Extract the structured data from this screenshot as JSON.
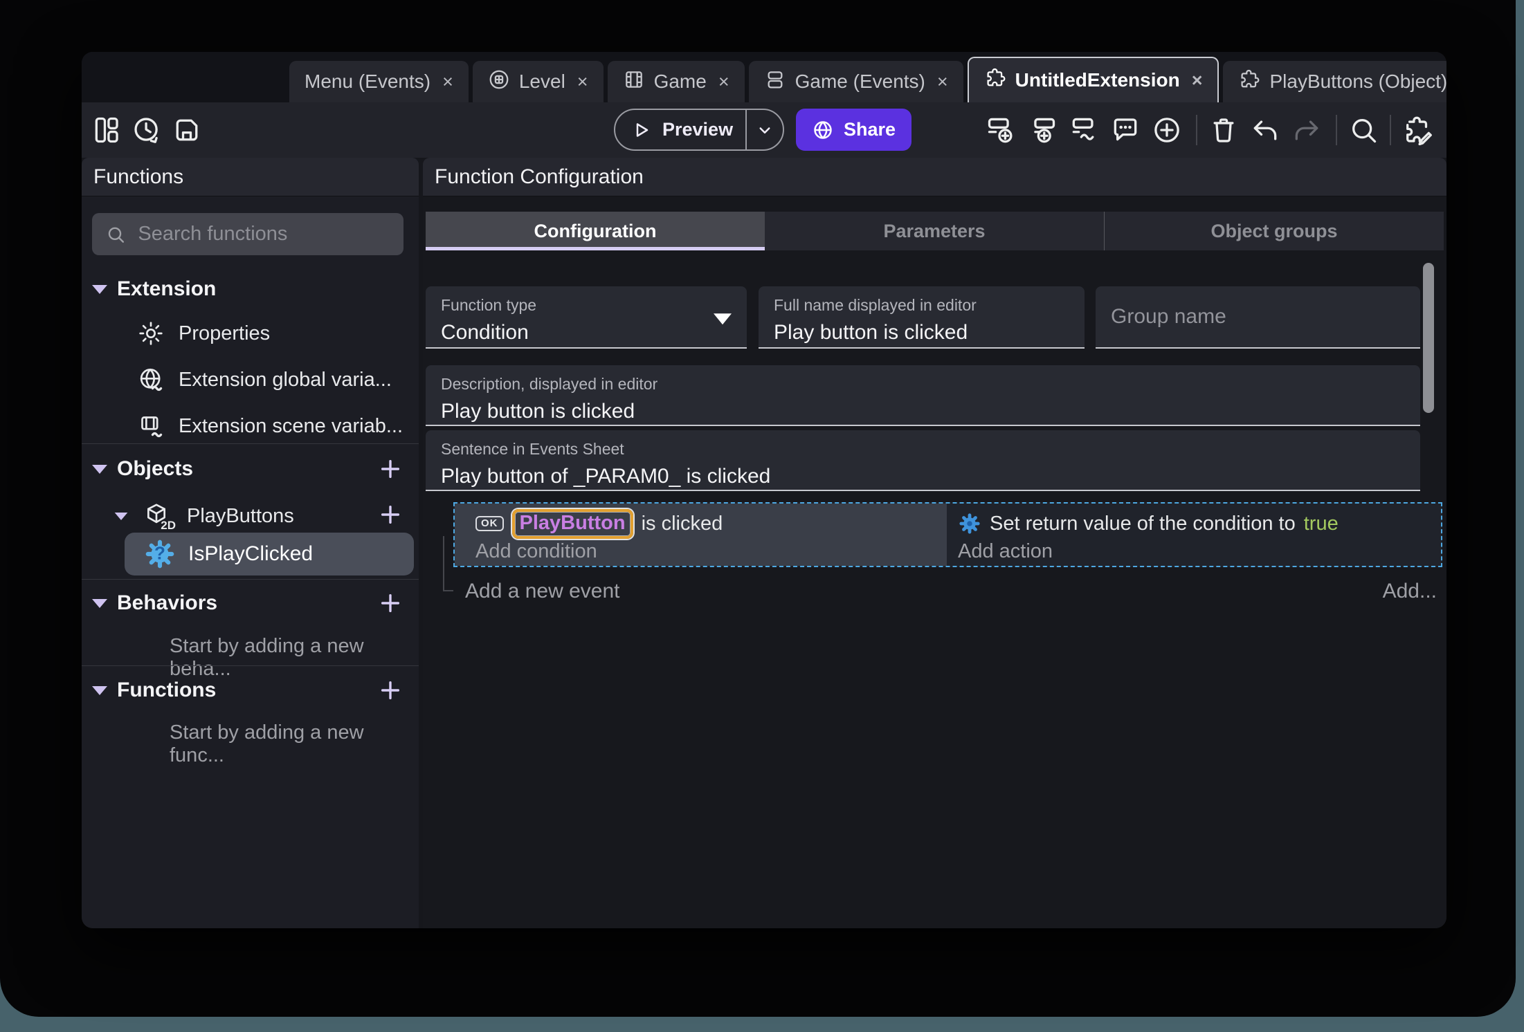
{
  "window_tabs": {
    "close_glyph": "×",
    "tabs": [
      {
        "label": "Menu (Events)"
      },
      {
        "label": "Level"
      },
      {
        "label": "Game"
      },
      {
        "label": "Game (Events)"
      },
      {
        "label": "UntitledExtension"
      },
      {
        "label": "PlayButtons (Object)"
      }
    ]
  },
  "toolbar": {
    "preview_label": "Preview",
    "share_label": "Share"
  },
  "sidebar": {
    "title": "Functions",
    "search_placeholder": "Search functions",
    "extension_section": {
      "label": "Extension",
      "items": [
        {
          "label": "Properties"
        },
        {
          "label": "Extension global varia..."
        },
        {
          "label": "Extension scene variab..."
        }
      ]
    },
    "objects_section": {
      "label": "Objects",
      "object_label": "PlayButtons",
      "object_badge": "2D",
      "function_label": "IsPlayClicked",
      "function_badge": "?"
    },
    "behaviors_section": {
      "label": "Behaviors",
      "hint": "Start by adding a new beha..."
    },
    "functions_section": {
      "label": "Functions",
      "hint": "Start by adding a new func..."
    }
  },
  "main": {
    "title": "Function Configuration",
    "tabs": [
      {
        "label": "Configuration"
      },
      {
        "label": "Parameters"
      },
      {
        "label": "Object groups"
      }
    ],
    "fields": {
      "function_type": {
        "label": "Function type",
        "value": "Condition"
      },
      "full_name": {
        "label": "Full name displayed in editor",
        "value": "Play button is clicked"
      },
      "group_name": {
        "placeholder": "Group name"
      },
      "description": {
        "label": "Description, displayed in editor",
        "value": "Play button is clicked"
      },
      "sentence": {
        "label": "Sentence in Events Sheet",
        "value": "Play button of _PARAM0_ is clicked"
      }
    },
    "events_sheet": {
      "condition": {
        "object_button_label": "OK",
        "object_name": "PlayButton",
        "text": "is clicked",
        "add_label": "Add condition"
      },
      "action": {
        "text": "Set return value of the condition to",
        "value": "true",
        "add_label": "Add action"
      },
      "add_event_label": "Add a new event",
      "add_more_label": "Add..."
    }
  },
  "colors": {
    "share_purple": "#5b31e0",
    "accent_lavender": "#cfc3f0",
    "selection_blue": "#4da8e2",
    "object_chip_text": "#c97fe3",
    "object_chip_border": "#e2a030",
    "true_green": "#a3c95f"
  }
}
